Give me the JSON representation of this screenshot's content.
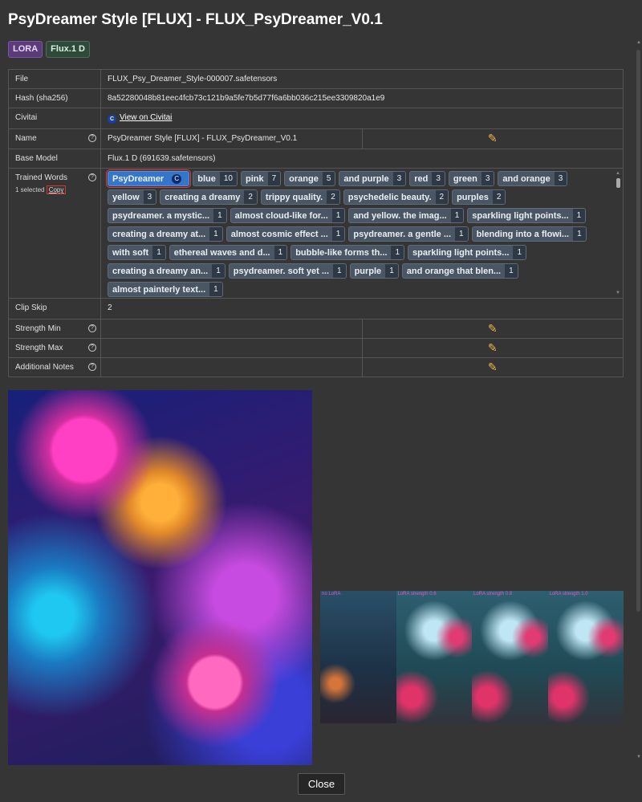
{
  "window": {
    "title": "PsyDreamer Style [FLUX] - FLUX_PsyDreamer_V0.1"
  },
  "badges": [
    "LORA",
    "Flux.1 D"
  ],
  "fields": {
    "file": {
      "label": "File",
      "value": "FLUX_Psy_Dreamer_Style-000007.safetensors"
    },
    "hash": {
      "label": "Hash (sha256)",
      "value": "8a52280048b81eec4fcb73c121b9a5fe7b5d77f6a6bb036c215ee3309820a1e9"
    },
    "civitai": {
      "label": "Civitai",
      "link_text": "View on Civitai",
      "icon": "civitai-icon"
    },
    "name": {
      "label": "Name",
      "value": "PsyDreamer Style [FLUX] - FLUX_PsyDreamer_V0.1"
    },
    "base_model": {
      "label": "Base Model",
      "value": "Flux.1 D (691639.safetensors)"
    },
    "trained_words": {
      "label": "Trained Words",
      "selected_text": "1 selected",
      "copy_label": "Copy"
    },
    "clip_skip": {
      "label": "Clip Skip",
      "value": "2"
    },
    "strength_min": {
      "label": "Strength Min",
      "value": ""
    },
    "strength_max": {
      "label": "Strength Max",
      "value": ""
    },
    "additional_notes": {
      "label": "Additional Notes",
      "value": ""
    }
  },
  "trained_words": [
    {
      "word": "PsyDreamer",
      "count": "",
      "selected": true
    },
    {
      "word": "blue",
      "count": "10"
    },
    {
      "word": "pink",
      "count": "7"
    },
    {
      "word": "orange",
      "count": "5"
    },
    {
      "word": "and purple",
      "count": "3"
    },
    {
      "word": "red",
      "count": "3"
    },
    {
      "word": "green",
      "count": "3"
    },
    {
      "word": "and orange",
      "count": "3"
    },
    {
      "word": "yellow",
      "count": "3"
    },
    {
      "word": "creating a dreamy",
      "count": "2"
    },
    {
      "word": "trippy quality.",
      "count": "2"
    },
    {
      "word": "psychedelic beauty.",
      "count": "2"
    },
    {
      "word": "purples",
      "count": "2"
    },
    {
      "word": "psydreamer. a mystic...",
      "count": "1"
    },
    {
      "word": "almost cloud-like for...",
      "count": "1"
    },
    {
      "word": "and yellow. the imag...",
      "count": "1"
    },
    {
      "word": "sparkling light points...",
      "count": "1"
    },
    {
      "word": "creating a dreamy at...",
      "count": "1"
    },
    {
      "word": "almost cosmic effect ...",
      "count": "1"
    },
    {
      "word": "psydreamer. a gentle ...",
      "count": "1"
    },
    {
      "word": "blending into a flowi...",
      "count": "1"
    },
    {
      "word": "with soft",
      "count": "1"
    },
    {
      "word": "ethereal waves and d...",
      "count": "1"
    },
    {
      "word": "bubble-like forms th...",
      "count": "1"
    },
    {
      "word": "sparkling light points...",
      "count": "1"
    },
    {
      "word": "creating a dreamy an...",
      "count": "1"
    },
    {
      "word": "psydreamer. soft yet ...",
      "count": "1"
    },
    {
      "word": "purple",
      "count": "1"
    },
    {
      "word": "and orange that blen...",
      "count": "1"
    },
    {
      "word": "almost painterly text...",
      "count": "1"
    }
  ],
  "preview_grid_labels": [
    "no LoRA",
    "LoRA strength 0.6",
    "LoRA strength 0.8",
    "LoRA strength 1.0"
  ],
  "icons": {
    "edit": "pencil-icon",
    "help": "help-icon"
  },
  "colors": {
    "background": "#353535",
    "selected_chip": "#3676c9",
    "chip": "#4a5664",
    "edit_pencil": "#f0b54a"
  },
  "buttons": {
    "close": "Close"
  }
}
